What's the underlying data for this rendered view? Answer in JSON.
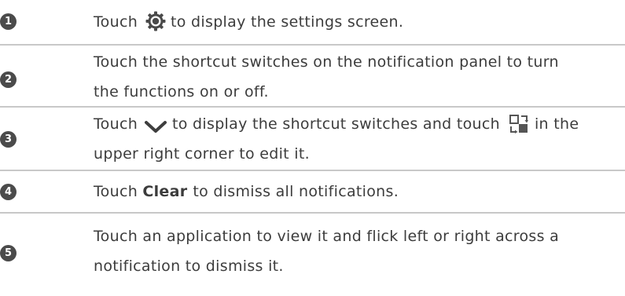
{
  "steps": [
    {
      "number": "1",
      "before": "Touch",
      "icon": "settings-gear-icon",
      "after": "to display the settings screen."
    },
    {
      "number": "2",
      "line1": "Touch the shortcut switches on the notification panel to turn",
      "line2": "the functions on or off."
    },
    {
      "number": "3",
      "before": "Touch",
      "icon": "chevron-down-icon",
      "middle": "to display the shortcut switches and touch",
      "icon2": "edit-switches-icon",
      "after": "in the",
      "line2": "upper right corner to edit it."
    },
    {
      "number": "4",
      "before": "Touch",
      "bold": "Clear",
      "after": "to dismiss all notifications."
    },
    {
      "number": "5",
      "line1": "Touch an application to view it and flick left or right across a",
      "line2": "notification to dismiss it."
    }
  ],
  "colors": {
    "badge": "#4b4b4b",
    "text": "#3c3c3c",
    "divider": "#c8c8c8"
  }
}
